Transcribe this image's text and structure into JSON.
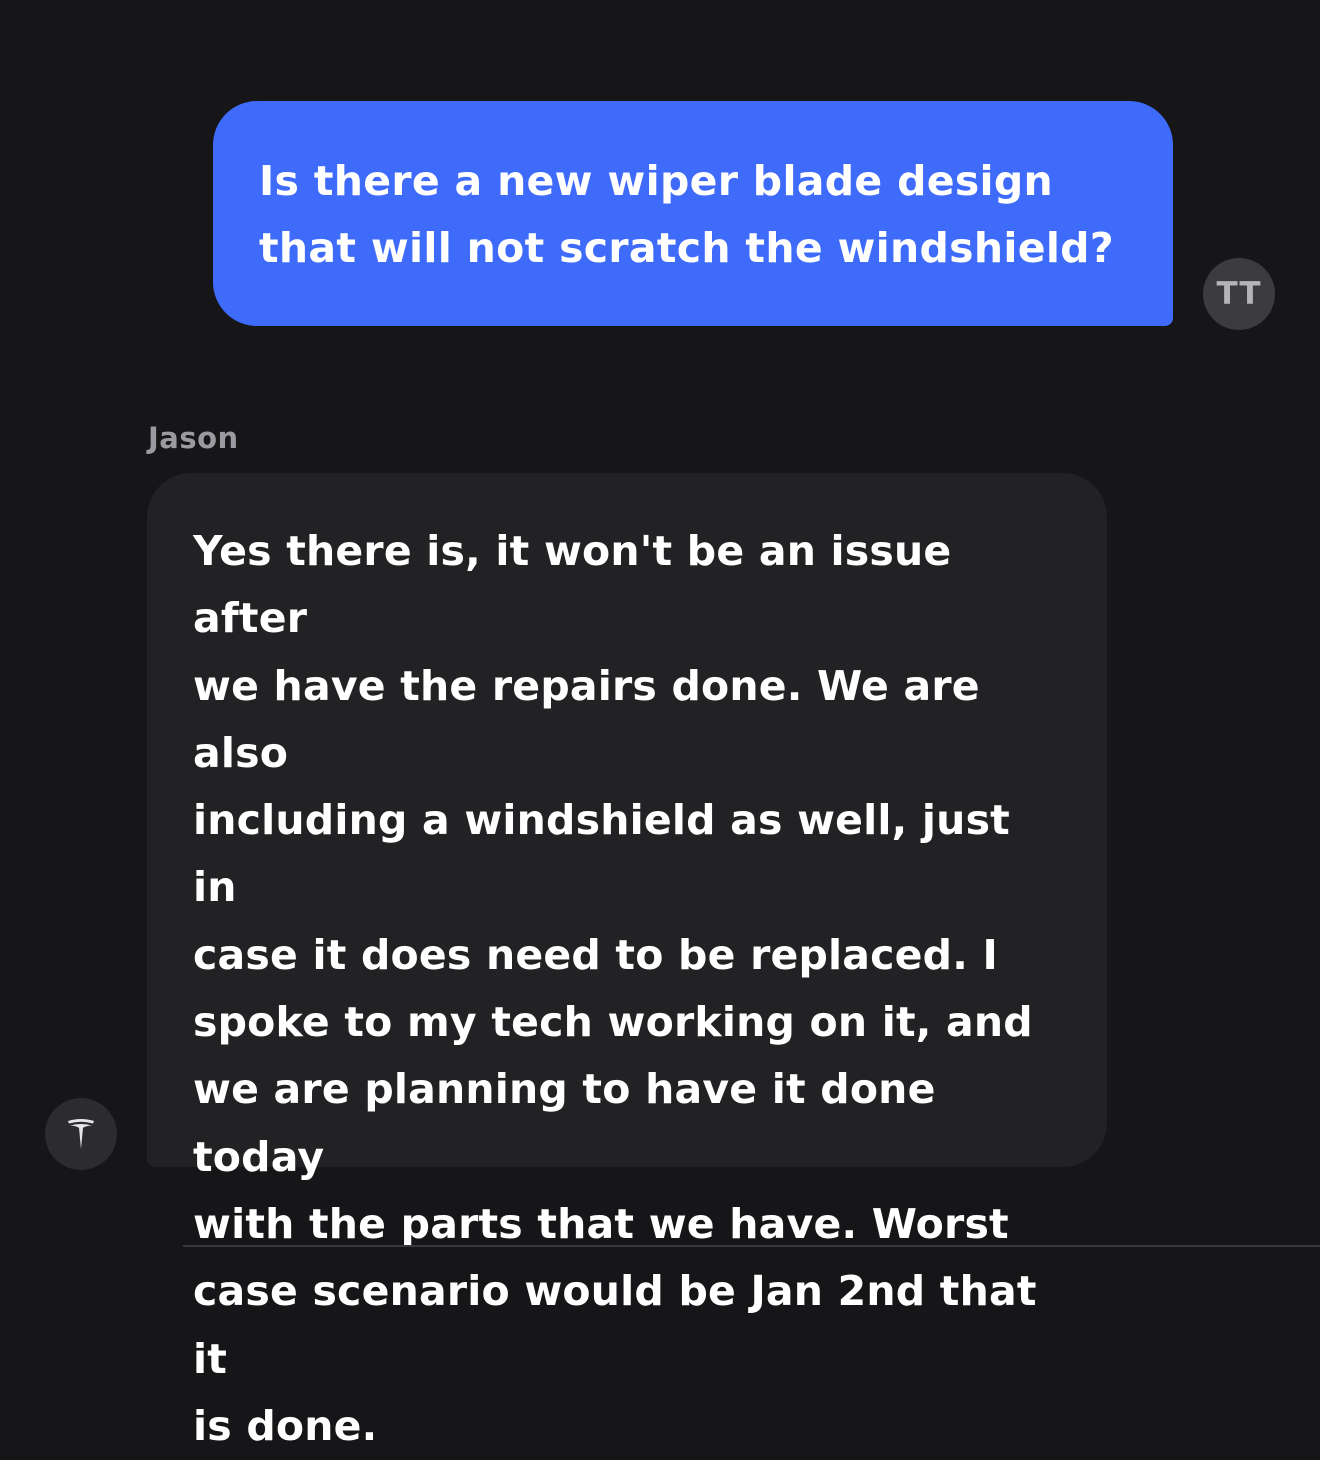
{
  "conversation": {
    "user_message": {
      "text": "Is there a new wiper blade design that will not scratch the windshield?",
      "avatar_initials": "TT"
    },
    "agent_message": {
      "sender_name": "Jason",
      "text": "Yes there is, it won't be an issue after\nwe have the repairs done. We are also\nincluding a windshield as well, just in\ncase it does need to be replaced.  I\nspoke to my tech working on it, and\nwe are planning to have it done today\nwith the parts that we have. Worst\ncase scenario would be Jan 2nd that it\nis done.",
      "avatar_icon": "tesla-logo-icon"
    }
  },
  "colors": {
    "background": "#161618",
    "user_bubble": "#3e6bfa",
    "agent_bubble": "#222224",
    "agent_name": "#9a9aa0"
  }
}
